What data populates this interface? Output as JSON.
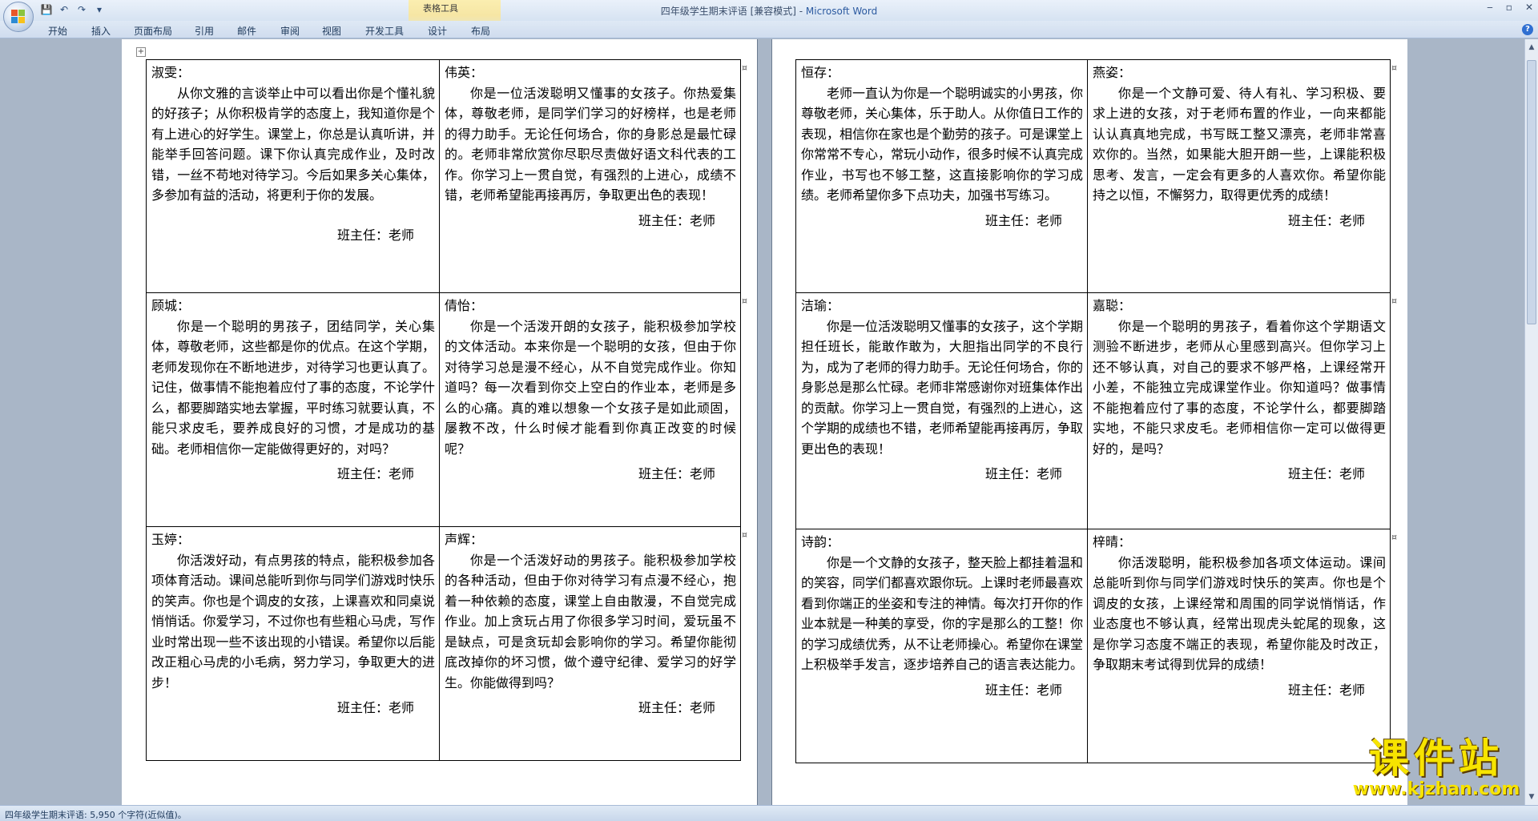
{
  "window": {
    "title": "四年级学生期末评语 [兼容模式] - ",
    "app_name": "Microsoft Word",
    "context_tab_group": "表格工具",
    "controls": [
      "‒",
      "▫",
      "✕"
    ]
  },
  "ribbon": {
    "tabs": [
      "开始",
      "插入",
      "页面布局",
      "引用",
      "邮件",
      "审阅",
      "视图",
      "开发工具",
      "设计",
      "布局"
    ]
  },
  "marks": {
    "paragraph": "↵",
    "cell_end": "¤"
  },
  "pages": [
    {
      "rows": [
        [
          {
            "name": "淑雯：",
            "body": "从你文雅的言谈举止中可以看出你是个懂礼貌的好孩子；从你积极肯学的态度上，我知道你是个有上进心的好学生。课堂上，你总是认真听讲，并能举手回答问题。课下你认真完成作业，及时改错，一丝不苟地对待学习。今后如果多关心集体，多参加有益的活动，将更利于你的发展。",
            "signature": "班主任：老师"
          },
          {
            "name": "伟英：",
            "body": "你是一位活泼聪明又懂事的女孩子。你热爱集体，尊敬老师，是同学们学习的好榜样，也是老师的得力助手。无论任何场合，你的身影总是最忙碌的。老师非常欣赏你尽职尽责做好语文科代表的工作。你学习上一贯自觉，有强烈的上进心，成绩不错，老师希望能再接再厉，争取更出色的表现！",
            "signature": "班主任：老师"
          }
        ],
        [
          {
            "name": "顾城：",
            "body": "你是一个聪明的男孩子，团结同学，关心集体，尊敬老师，这些都是你的优点。在这个学期，老师发现你在不断地进步，对待学习也更认真了。记住，做事情不能抱着应付了事的态度，不论学什么，都要脚踏实地去掌握，平时练习就要认真，不能只求皮毛，要养成良好的习惯，才是成功的基础。老师相信你一定能做得更好的，对吗？",
            "signature": "班主任：老师"
          },
          {
            "name": "倩怡：",
            "body": "你是一个活泼开朗的女孩子，能积极参加学校的文体活动。本来你是一个聪明的女孩，但由于你对待学习总是漫不经心，从不自觉完成作业。你知道吗？每一次看到你交上空白的作业本，老师是多么的心痛。真的难以想象一个女孩子是如此顽固，屡教不改，什么时候才能看到你真正改变的时候呢？",
            "signature": "班主任：老师"
          }
        ],
        [
          {
            "name": "玉婷：",
            "body": "你活泼好动，有点男孩的特点，能积极参加各项体育活动。课间总能听到你与同学们游戏时快乐的笑声。你也是个调皮的女孩，上课喜欢和同桌说悄悄话。你爱学习，不过你也有些粗心马虎，写作业时常出现一些不该出现的小错误。希望你以后能改正粗心马虎的小毛病，努力学习，争取更大的进步！",
            "signature": "班主任：老师"
          },
          {
            "name": "声辉：",
            "body": "你是一个活泼好动的男孩子。能积极参加学校的各种活动，但由于你对待学习有点漫不经心，抱着一种依赖的态度，课堂上自由散漫，不自觉完成作业。加上贪玩占用了你很多学习时间，爱玩虽不是缺点，可是贪玩却会影响你的学习。希望你能彻底改掉你的坏习惯，做个遵守纪律、爱学习的好学生。你能做得到吗？",
            "signature": "班主任：老师"
          }
        ]
      ]
    },
    {
      "rows": [
        [
          {
            "name": "恒存：",
            "body": "老师一直认为你是一个聪明诚实的小男孩，你尊敬老师，关心集体，乐于助人。从你值日工作的表现，相信你在家也是个勤劳的孩子。可是课堂上你常常不专心，常玩小动作，很多时候不认真完成作业，书写也不够工整，这直接影响你的学习成绩。老师希望你多下点功夫，加强书写练习。",
            "signature": "班主任：老师"
          },
          {
            "name": "燕姿：",
            "body": "你是一个文静可爱、待人有礼、学习积极、要求上进的女孩，对于老师布置的作业，一向来都能认认真真地完成，书写既工整又漂亮，老师非常喜欢你的。当然，如果能大胆开朗一些，上课能积极思考、发言，一定会有更多的人喜欢你。希望你能持之以恒，不懈努力，取得更优秀的成绩！",
            "signature": "班主任：老师"
          }
        ],
        [
          {
            "name": "洁瑜：",
            "body": "你是一位活泼聪明又懂事的女孩子，这个学期担任班长，能敢作敢为，大胆指出同学的不良行为，成为了老师的得力助手。无论任何场合，你的身影总是那么忙碌。老师非常感谢你对班集体作出的贡献。你学习上一贯自觉，有强烈的上进心，这个学期的成绩也不错，老师希望能再接再厉，争取更出色的表现！",
            "signature": "班主任：老师"
          },
          {
            "name": "嘉聪：",
            "body": "你是一个聪明的男孩子，看着你这个学期语文测验不断进步，老师从心里感到高兴。但你学习上还不够认真，对自己的要求不够严格，上课经常开小差，不能独立完成课堂作业。你知道吗？做事情不能抱着应付了事的态度，不论学什么，都要脚踏实地，不能只求皮毛。老师相信你一定可以做得更好的，是吗？",
            "signature": "班主任：老师"
          }
        ],
        [
          {
            "name": "诗韵：",
            "body": "你是一个文静的女孩子，整天脸上都挂着温和的笑容，同学们都喜欢跟你玩。上课时老师最喜欢看到你端正的坐姿和专注的神情。每次打开你的作业本就是一种美的享受，你的字是那么的工整！你的学习成绩优秀，从不让老师操心。希望你在课堂上积极举手发言，逐步培养自己的语言表达能力。",
            "signature": "班主任：老师"
          },
          {
            "name": "梓晴：",
            "body": "你活泼聪明，能积极参加各项文体运动。课间总能听到你与同学们游戏时快乐的笑声。你也是个调皮的女孩，上课经常和周围的同学说悄悄话，作业态度也不够认真，经常出现虎头蛇尾的现象，这是你学习态度不端正的表现，希望你能及时改正，争取期末考试得到优异的成绩！",
            "signature": "班主任：老师"
          }
        ]
      ]
    }
  ],
  "status": {
    "text": "四年级学生期末评语: 5,950 个字符(近似值)。"
  },
  "watermark": {
    "title": "课件站",
    "url": "www.kjzhan.com"
  }
}
